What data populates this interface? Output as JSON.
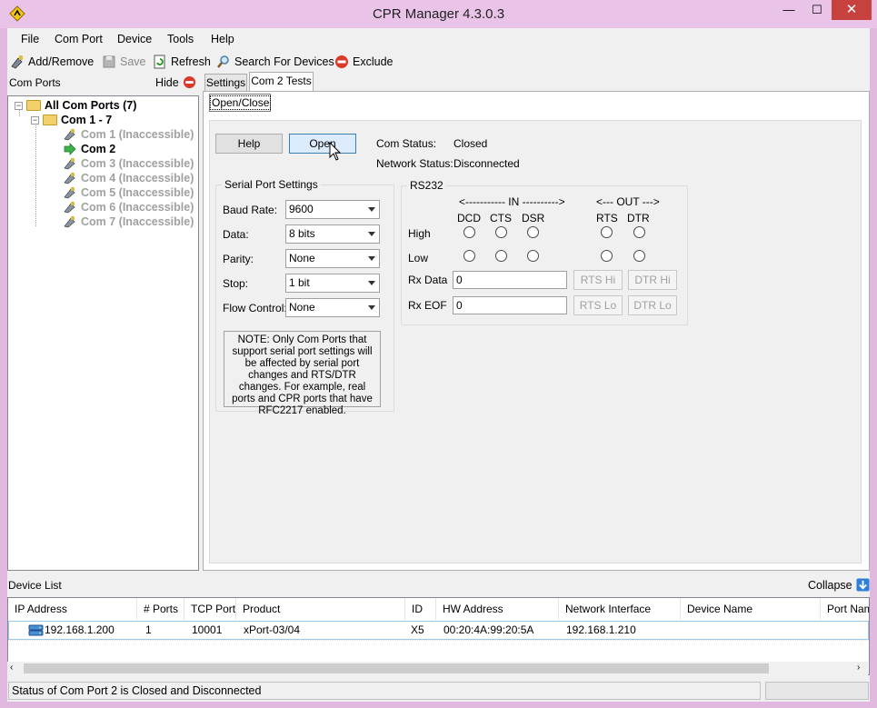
{
  "window": {
    "title": "CPR Manager 4.3.0.3",
    "min": "—",
    "max": "☐",
    "close": "✕"
  },
  "menu": [
    "File",
    "Com Port",
    "Device",
    "Tools",
    "Help"
  ],
  "toolbar": {
    "add_remove": "Add/Remove",
    "save": "Save",
    "refresh": "Refresh",
    "search": "Search For Devices",
    "exclude": "Exclude"
  },
  "left_panel": {
    "title": "Com Ports",
    "hide": "Hide"
  },
  "tree": {
    "root": "All Com Ports (7)",
    "group": "Com 1 - 7",
    "ports": [
      {
        "label": "Com 1 (Inaccessible)",
        "accessible": false
      },
      {
        "label": "Com 2",
        "accessible": true
      },
      {
        "label": "Com 3 (Inaccessible)",
        "accessible": false
      },
      {
        "label": "Com 4 (Inaccessible)",
        "accessible": false
      },
      {
        "label": "Com 5 (Inaccessible)",
        "accessible": false
      },
      {
        "label": "Com 6 (Inaccessible)",
        "accessible": false
      },
      {
        "label": "Com 7 (Inaccessible)",
        "accessible": false
      }
    ]
  },
  "tabs": {
    "settings": "Settings",
    "tests": "Com 2 Tests",
    "subtab": "Open/Close"
  },
  "tests": {
    "help": "Help",
    "open": "Open",
    "com_status_label": "Com Status:",
    "com_status_value": "Closed",
    "net_status_label": "Network Status:",
    "net_status_value": "Disconnected"
  },
  "serial": {
    "title": "Serial Port Settings",
    "baud_label": "Baud Rate:",
    "baud": "9600",
    "data_label": "Data:",
    "data": "8 bits",
    "parity_label": "Parity:",
    "parity": "None",
    "stop_label": "Stop:",
    "stop": "1 bit",
    "flow_label": "Flow Control:",
    "flow": "None",
    "note": "NOTE: Only Com Ports that support serial port settings will be affected by serial port changes and RTS/DTR changes.  For example, real ports and CPR ports that have RFC2217 enabled."
  },
  "rs232": {
    "title": "RS232",
    "in": "<----------- IN ---------->",
    "out": "<--- OUT --->",
    "dcd": "DCD",
    "cts": "CTS",
    "dsr": "DSR",
    "rts": "RTS",
    "dtr": "DTR",
    "high": "High",
    "low": "Low",
    "rxdata_label": "Rx Data",
    "rxdata": "0",
    "rxeof_label": "Rx EOF",
    "rxeof": "0",
    "rts_hi": "RTS Hi",
    "dtr_hi": "DTR Hi",
    "rts_lo": "RTS Lo",
    "dtr_lo": "DTR Lo"
  },
  "device_list": {
    "title": "Device List",
    "collapse": "Collapse",
    "columns": [
      "IP Address",
      "# Ports",
      "TCP Port",
      "Product",
      "ID",
      "HW Address",
      "Network Interface",
      "Device Name",
      "Port Name"
    ],
    "rows": [
      [
        "192.168.1.200",
        "1",
        "10001",
        "xPort-03/04",
        "X5",
        "00:20:4A:99:20:5A",
        "192.168.1.210",
        "",
        ""
      ]
    ]
  },
  "status": "Status of Com Port 2 is Closed and Disconnected",
  "colors": {
    "titlebar": "#e9c4e8",
    "frame": "#e1b8e0",
    "close": "#c7423f",
    "hot_button": "#dcecfc"
  }
}
